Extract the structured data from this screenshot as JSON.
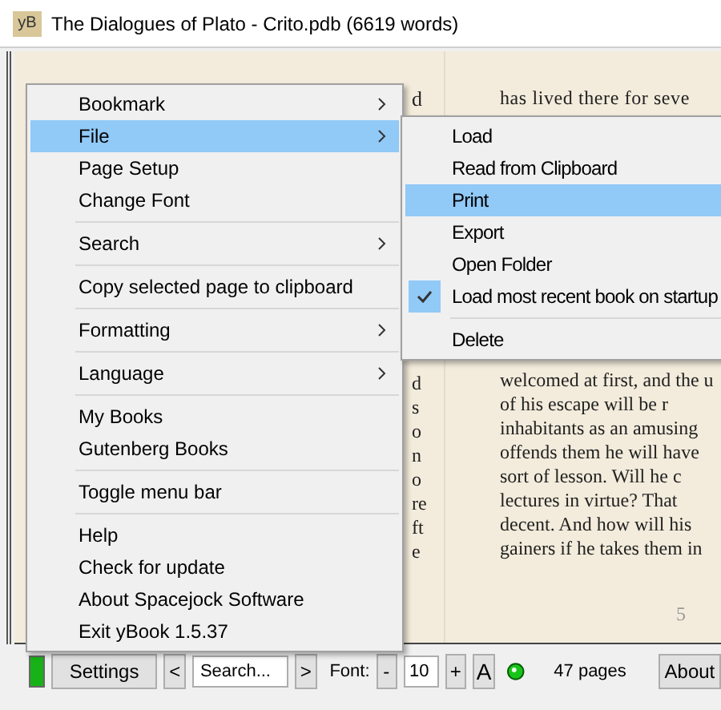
{
  "window": {
    "app_icon": "yB",
    "title": "The Dialogues of Plato - Crito.pdb (6619 words)"
  },
  "book": {
    "left_fragments": [
      "d",
      "d",
      "s",
      "o",
      "n",
      "o",
      "re",
      "ft",
      "e"
    ],
    "right_top_line": "has lived there for seve",
    "right_lines": [
      "welcomed at first, and the u",
      "of his escape will be r",
      "inhabitants as an amusing",
      "offends them he will have",
      "sort of lesson. Will he c",
      "lectures in virtue? That",
      "decent. And how will his",
      "gainers if he takes them in"
    ],
    "page_number": "5"
  },
  "context_menu": {
    "groups": [
      [
        {
          "label": "Bookmark",
          "submenu": true,
          "selected": false
        },
        {
          "label": "File",
          "submenu": true,
          "selected": true
        },
        {
          "label": "Page Setup",
          "submenu": false,
          "selected": false
        },
        {
          "label": "Change Font",
          "submenu": false,
          "selected": false
        }
      ],
      [
        {
          "label": "Search",
          "submenu": true,
          "selected": false
        }
      ],
      [
        {
          "label": "Copy selected page to clipboard",
          "submenu": false,
          "selected": false
        }
      ],
      [
        {
          "label": "Formatting",
          "submenu": true,
          "selected": false
        }
      ],
      [
        {
          "label": "Language",
          "submenu": true,
          "selected": false
        }
      ],
      [
        {
          "label": "My Books",
          "submenu": false,
          "selected": false
        },
        {
          "label": "Gutenberg Books",
          "submenu": false,
          "selected": false
        }
      ],
      [
        {
          "label": "Toggle menu bar",
          "submenu": false,
          "selected": false
        }
      ],
      [
        {
          "label": "Help",
          "submenu": false,
          "selected": false
        },
        {
          "label": "Check for update",
          "submenu": false,
          "selected": false
        },
        {
          "label": "About Spacejock Software",
          "submenu": false,
          "selected": false
        },
        {
          "label": "Exit yBook 1.5.37",
          "submenu": false,
          "selected": false
        }
      ]
    ]
  },
  "file_submenu": {
    "groups": [
      [
        {
          "label": "Load",
          "selected": false,
          "checked": false
        },
        {
          "label": "Read from Clipboard",
          "selected": false,
          "checked": false
        },
        {
          "label": "Print",
          "selected": true,
          "checked": false
        },
        {
          "label": "Export",
          "selected": false,
          "checked": false
        },
        {
          "label": "Open Folder",
          "selected": false,
          "checked": false
        },
        {
          "label": "Load most recent book on startup",
          "selected": false,
          "checked": true
        }
      ],
      [
        {
          "label": "Delete",
          "selected": false,
          "checked": false
        }
      ]
    ]
  },
  "toolbar": {
    "settings": "Settings",
    "prev": "<",
    "search_placeholder": "Search...",
    "next": ">",
    "font_label": "Font:",
    "font_minus": "-",
    "font_size": "10",
    "font_plus": "+",
    "font_button": "A",
    "pages": "47 pages",
    "about": "About"
  }
}
